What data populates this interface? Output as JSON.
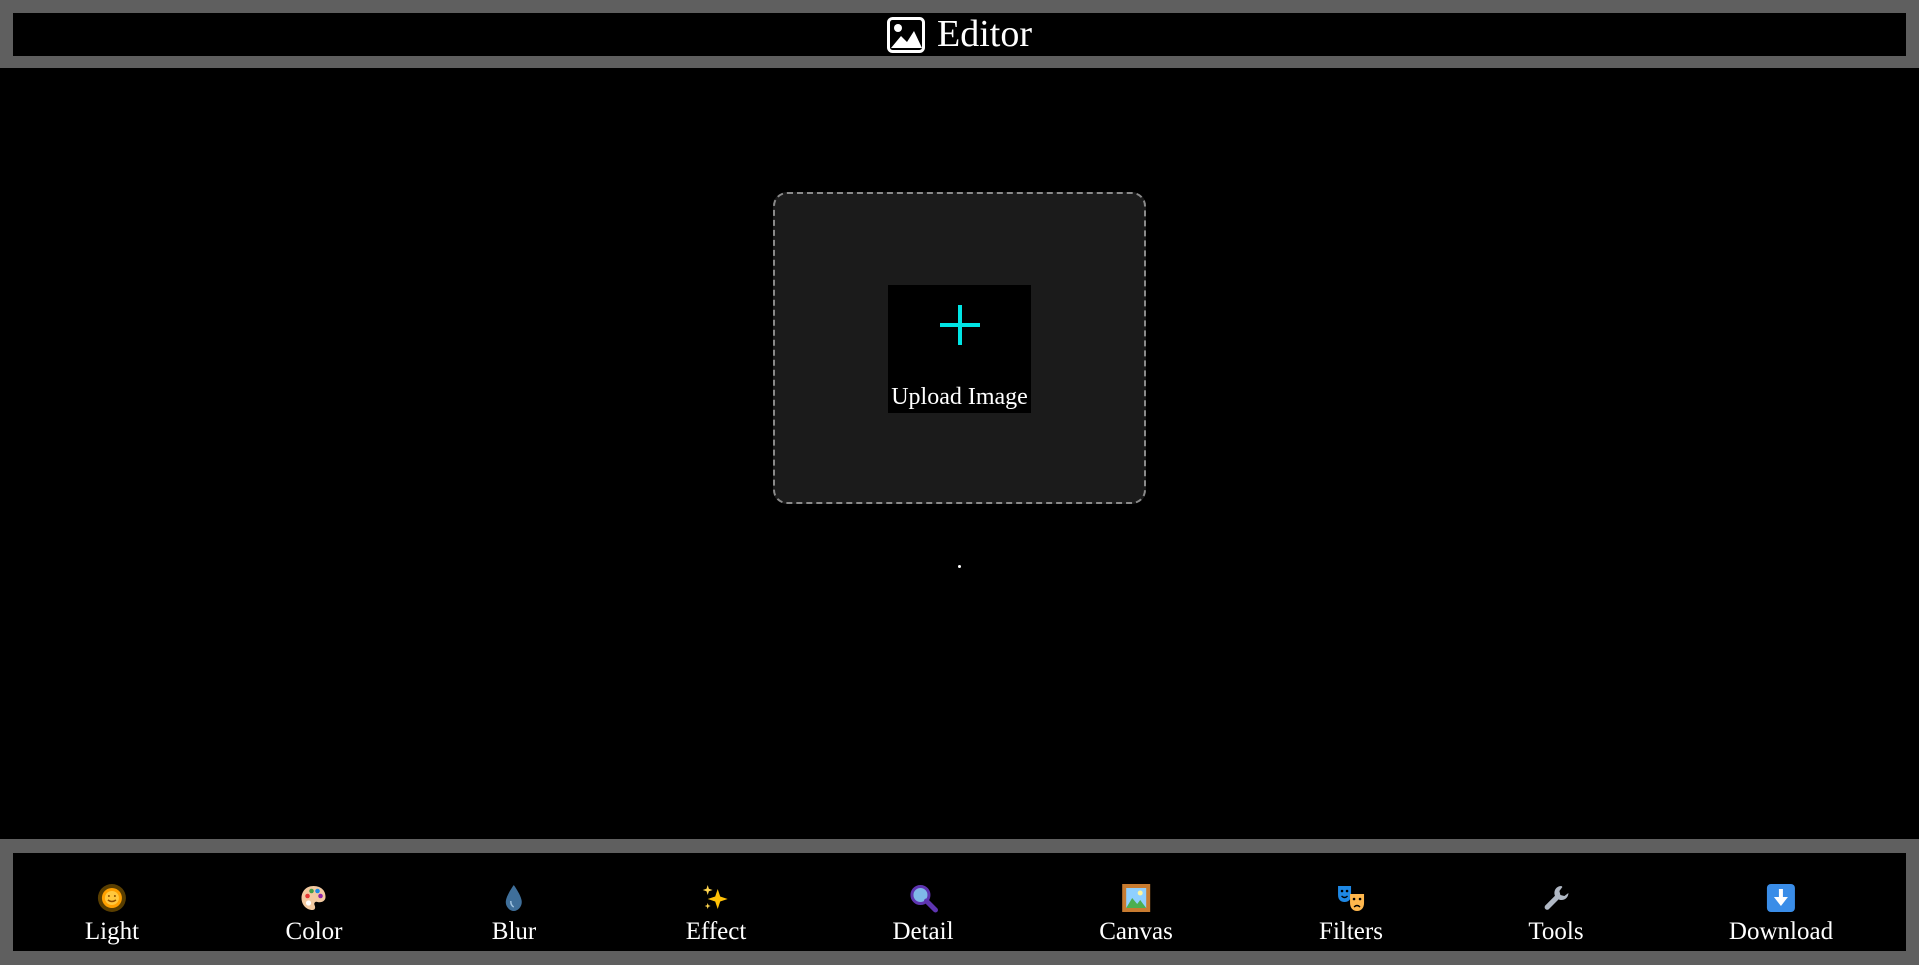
{
  "header": {
    "title": "Editor",
    "icon": "image-icon"
  },
  "upload": {
    "label": "Upload Image",
    "icon": "plus-icon",
    "accent_color": "#00e5e5"
  },
  "toolbar": {
    "items": [
      {
        "label": "Light",
        "icon": "sun-icon"
      },
      {
        "label": "Color",
        "icon": "palette-icon"
      },
      {
        "label": "Blur",
        "icon": "droplet-icon"
      },
      {
        "label": "Effect",
        "icon": "sparkles-icon"
      },
      {
        "label": "Detail",
        "icon": "magnifier-icon"
      },
      {
        "label": "Canvas",
        "icon": "framed-picture-icon"
      },
      {
        "label": "Filters",
        "icon": "theater-masks-icon"
      },
      {
        "label": "Tools",
        "icon": "wrench-icon"
      },
      {
        "label": "Download",
        "icon": "download-arrow-icon"
      }
    ]
  }
}
